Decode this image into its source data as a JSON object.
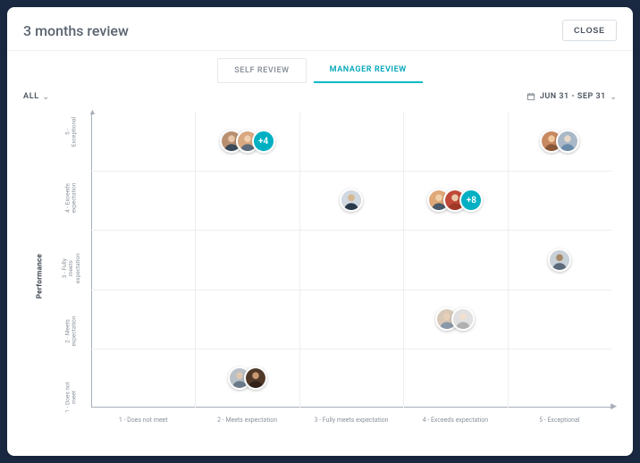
{
  "header": {
    "title": "3 months review",
    "close_label": "CLOSE"
  },
  "tabs": {
    "self": "SELF REVIEW",
    "manager": "MANAGER REVIEW"
  },
  "controls": {
    "filter_label": "ALL",
    "date_range": "JUN 31 - SEP 31"
  },
  "axes": {
    "y_title": "Performance",
    "y_ticks": [
      "1 - Does not meet",
      "2 - Meets expectation",
      "3 - Fully meets expectation",
      "4 - Exceeds expectation",
      "5 - Exceptional"
    ],
    "x_ticks": [
      "1 - Does not meet",
      "2 - Meets expectation",
      "3 - Fully meets expectation",
      "4 - Exceeds expectation",
      "5 - Exceptional"
    ]
  },
  "chart_data": {
    "type": "scatter",
    "title": "3 months review",
    "xlabel": "",
    "ylabel": "Performance",
    "xlim": [
      1,
      5
    ],
    "ylim": [
      1,
      5
    ],
    "x_categories": [
      "1 - Does not meet",
      "2 - Meets expectation",
      "3 - Fully meets expectation",
      "4 - Exceeds expectation",
      "5 - Exceptional"
    ],
    "y_categories": [
      "1 - Does not meet",
      "2 - Meets expectation",
      "3 - Fully meets expectation",
      "4 - Exceeds expectation",
      "5 - Exceptional"
    ],
    "series": [
      {
        "name": "Manager Review",
        "points": [
          {
            "x": 2,
            "y": 5,
            "visible_avatars": 2,
            "overflow": 4
          },
          {
            "x": 5,
            "y": 5,
            "visible_avatars": 2,
            "overflow": 0
          },
          {
            "x": 3,
            "y": 4,
            "visible_avatars": 1,
            "overflow": 0
          },
          {
            "x": 4,
            "y": 4,
            "visible_avatars": 2,
            "overflow": 8
          },
          {
            "x": 5,
            "y": 3,
            "visible_avatars": 1,
            "overflow": 0
          },
          {
            "x": 4,
            "y": 2,
            "visible_avatars": 2,
            "overflow": 0
          },
          {
            "x": 2,
            "y": 1,
            "visible_avatars": 2,
            "overflow": 0
          }
        ]
      }
    ],
    "overflow_labels": {
      "0": "+4",
      "1": "+8"
    }
  }
}
